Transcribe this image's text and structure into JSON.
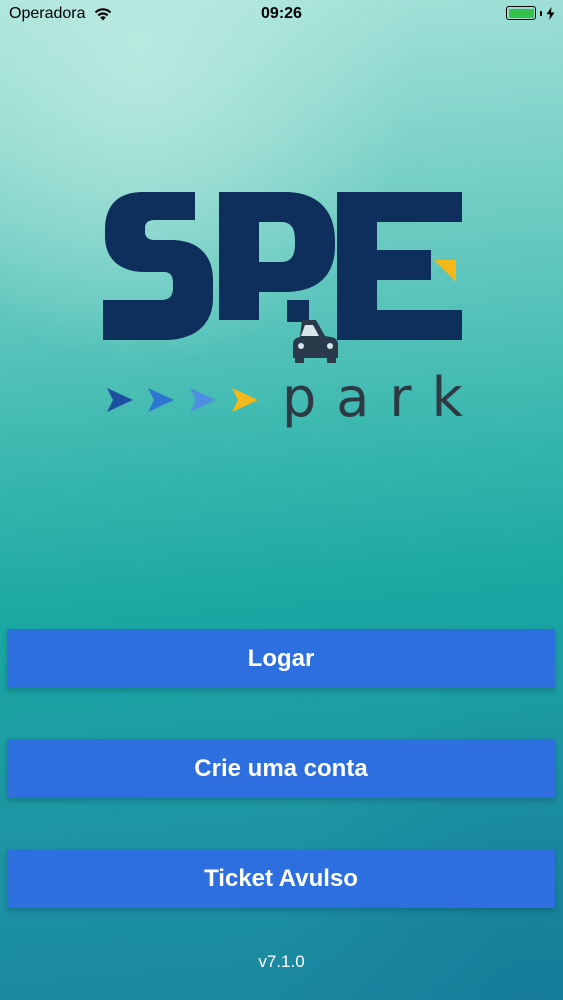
{
  "status_bar": {
    "carrier": "Operadora",
    "time": "09:26",
    "battery_level": 1.0,
    "charging": true,
    "icons": [
      "wifi-icon",
      "battery-icon",
      "charging-icon"
    ]
  },
  "logo": {
    "wordmark": "SPE",
    "sub_wordmark": "park",
    "colors": {
      "navy": "#0e2e5c",
      "accent_yellow": "#f4b819",
      "arrow_dark_blue": "#1c4fa0",
      "arrow_blue": "#2e74d1",
      "arrow_light_blue": "#4d8fe0"
    }
  },
  "buttons": {
    "login": "Logar",
    "signup": "Crie uma conta",
    "ticket": "Ticket Avulso"
  },
  "version": "v7.1.0",
  "colors": {
    "button_bg": "#2e6fe0",
    "button_text": "#ffffff",
    "background_top": "#a8e3db",
    "background_bottom": "#1a86a0"
  }
}
